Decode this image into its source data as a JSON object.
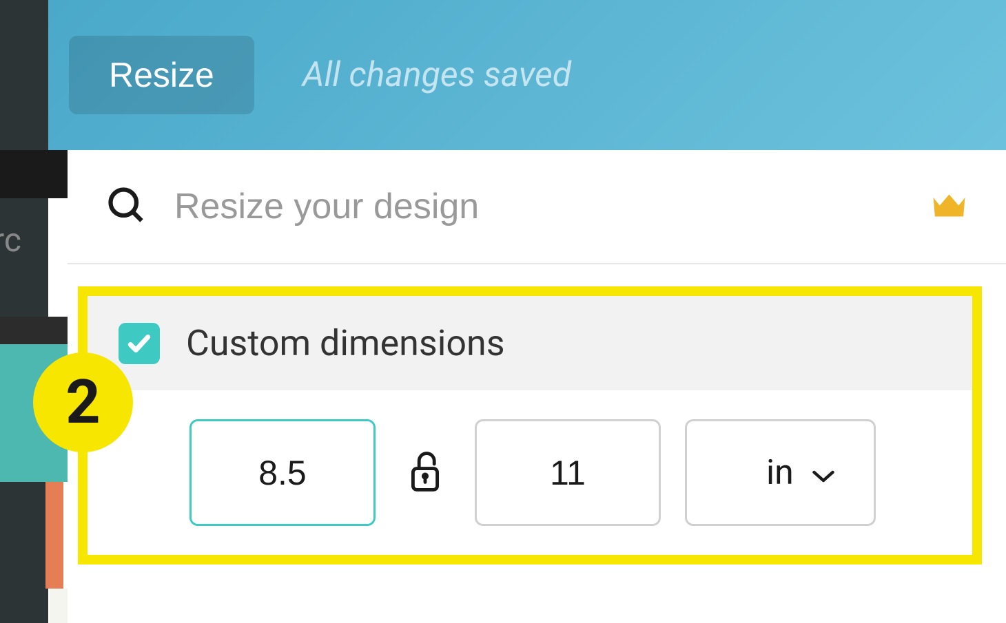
{
  "header": {
    "resize_label": "Resize",
    "saved_status": "All changes saved"
  },
  "search": {
    "placeholder": "Resize your design",
    "icon": "search-icon",
    "premium_icon": "crown-icon"
  },
  "annotation": {
    "step_number": "2"
  },
  "custom_dimensions": {
    "checked": true,
    "label": "Custom dimensions",
    "width_value": "8.5",
    "height_value": "11",
    "lock_state": "unlocked",
    "unit_value": "in"
  },
  "colors": {
    "accent_teal": "#3ec9c3",
    "highlight_yellow": "#f7e600",
    "header_gradient_start": "#4aa8c9",
    "header_gradient_end": "#6cc2dd",
    "crown_gold": "#f0b429"
  },
  "sidebar_partial_text": "rc"
}
